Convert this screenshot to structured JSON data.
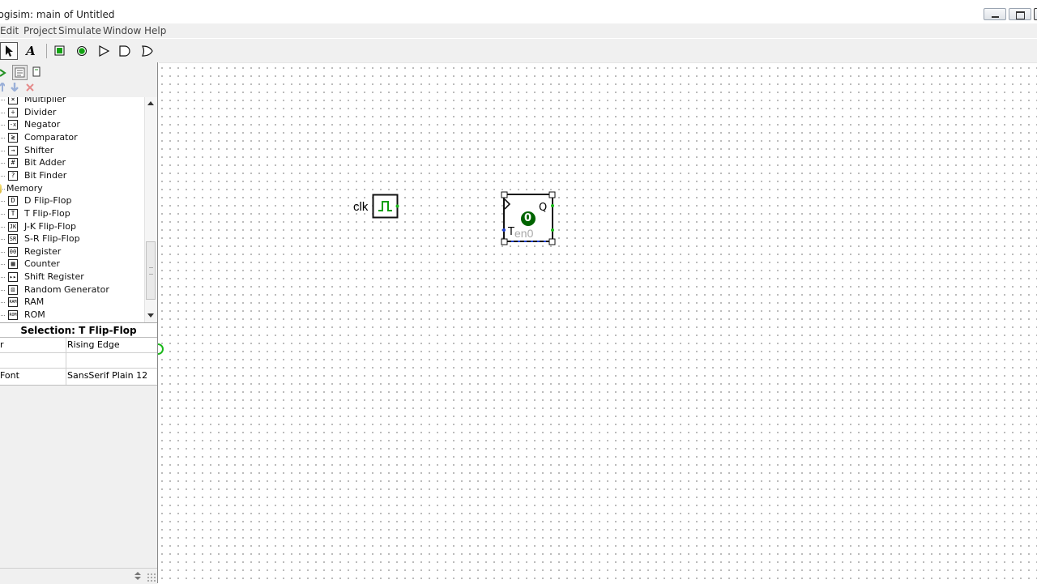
{
  "window": {
    "title": "Logisim: main of Untitled"
  },
  "menu": {
    "items": [
      "Edit",
      "Project",
      "Simulate",
      "Window",
      "Help"
    ]
  },
  "toolbar": {
    "text_tool": "A"
  },
  "explorer": {
    "items": [
      {
        "label": "Multiplier",
        "icon": "multiplier-icon",
        "glyph": "×"
      },
      {
        "label": "Divider",
        "icon": "divider-icon",
        "glyph": "÷"
      },
      {
        "label": "Negator",
        "icon": "negator-icon",
        "glyph": "-x"
      },
      {
        "label": "Comparator",
        "icon": "comparator-icon",
        "glyph": "≷"
      },
      {
        "label": "Shifter",
        "icon": "shifter-icon",
        "glyph": "→"
      },
      {
        "label": "Bit Adder",
        "icon": "bit-adder-icon",
        "glyph": "#"
      },
      {
        "label": "Bit Finder",
        "icon": "bit-finder-icon",
        "glyph": "?"
      },
      {
        "label": "Memory",
        "icon": "folder-icon",
        "glyph": "",
        "folder": true
      },
      {
        "label": "D Flip-Flop",
        "icon": "d-flip-flop-icon",
        "glyph": "D"
      },
      {
        "label": "T Flip-Flop",
        "icon": "t-flip-flop-icon",
        "glyph": "T"
      },
      {
        "label": "J-K Flip-Flop",
        "icon": "jk-flip-flop-icon",
        "glyph": "JK"
      },
      {
        "label": "S-R Flip-Flop",
        "icon": "sr-flip-flop-icon",
        "glyph": "SR"
      },
      {
        "label": "Register",
        "icon": "register-icon",
        "glyph": "00"
      },
      {
        "label": "Counter",
        "icon": "counter-icon",
        "glyph": "▦"
      },
      {
        "label": "Shift Register",
        "icon": "shift-register-icon",
        "glyph": "▸▸"
      },
      {
        "label": "Random Generator",
        "icon": "random-generator-icon",
        "glyph": "⚄"
      },
      {
        "label": "RAM",
        "icon": "ram-icon",
        "glyph": "RAM"
      },
      {
        "label": "ROM",
        "icon": "rom-icon",
        "glyph": "ROM"
      }
    ]
  },
  "selection": {
    "header": "Selection: T Flip-Flop",
    "attributes": [
      {
        "name": "r",
        "value": "Rising Edge"
      },
      {
        "name": "",
        "value": ""
      },
      {
        "name": "Font",
        "value": "SansSerif Plain 12"
      }
    ]
  },
  "circuit": {
    "clock_label": "clk",
    "ff_state": "0",
    "ff_output": "Q",
    "ff_input": "T",
    "ff_label": "en0"
  },
  "colors": {
    "wire_green": "#00a000",
    "state_dark_green": "#006400",
    "selection_blue": "#2040d0"
  }
}
